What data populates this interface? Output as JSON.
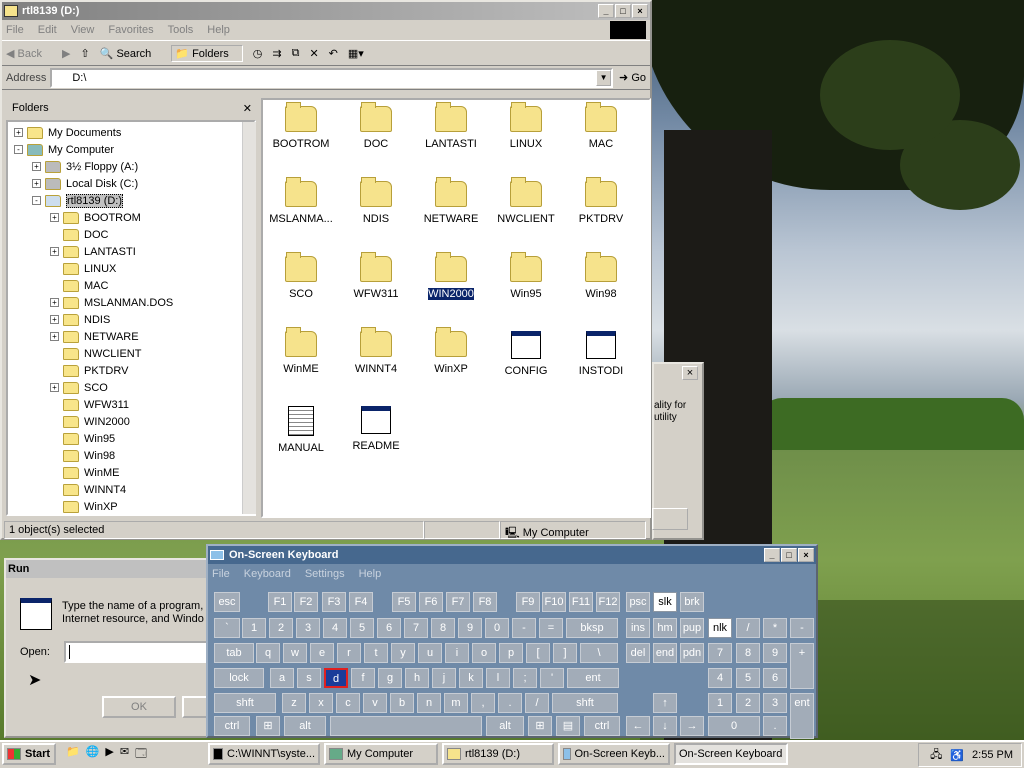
{
  "explorer": {
    "title": "rtl8139 (D:)",
    "menu": [
      "File",
      "Edit",
      "View",
      "Favorites",
      "Tools",
      "Help"
    ],
    "toolbar": {
      "back": "Back",
      "search": "Search",
      "folders": "Folders"
    },
    "address_label": "Address",
    "address_value": "D:\\",
    "go": "Go",
    "folders_pane_title": "Folders",
    "tree": [
      "My Documents",
      "My Computer",
      "3½ Floppy (A:)",
      "Local Disk (C:)",
      "rtl8139 (D:)",
      "BOOTROM",
      "DOC",
      "LANTASTI",
      "LINUX",
      "MAC",
      "MSLANMAN.DOS",
      "NDIS",
      "NETWARE",
      "NWCLIENT",
      "PKTDRV",
      "SCO",
      "WFW311",
      "WIN2000",
      "Win95",
      "Win98",
      "WinME",
      "WINNT4",
      "WinXP"
    ],
    "files": [
      "BOOTROM",
      "DOC",
      "LANTASTI",
      "LINUX",
      "MAC",
      "MSLANMA...",
      "NDIS",
      "NETWARE",
      "NWCLIENT",
      "PKTDRV",
      "SCO",
      "WFW311",
      "WIN2000",
      "Win95",
      "Win98",
      "WinME",
      "WINNT4",
      "WinXP",
      "CONFIG",
      "INSTODI",
      "MANUAL",
      "README"
    ],
    "status": "1 object(s) selected",
    "status_location": "My Computer"
  },
  "behind": {
    "text1": "ality for",
    "text2": "utility"
  },
  "run": {
    "title": "Run",
    "prompt": "Type the name of a program,",
    "prompt2": "Internet resource, and Windo",
    "open_label": "Open:",
    "ok": "OK"
  },
  "osk": {
    "title": "On-Screen Keyboard",
    "menu": [
      "File",
      "Keyboard",
      "Settings",
      "Help"
    ]
  },
  "taskbar": {
    "start": "Start",
    "tasks": [
      "C:\\WINNT\\syste...",
      "My Computer",
      "rtl8139 (D:)",
      "On-Screen Keyb...",
      "On-Screen Keyboard"
    ],
    "clock": "2:55 PM"
  },
  "colors": {
    "titlebar_active": "#0a246a",
    "selected_key": "#1a3c9a"
  }
}
